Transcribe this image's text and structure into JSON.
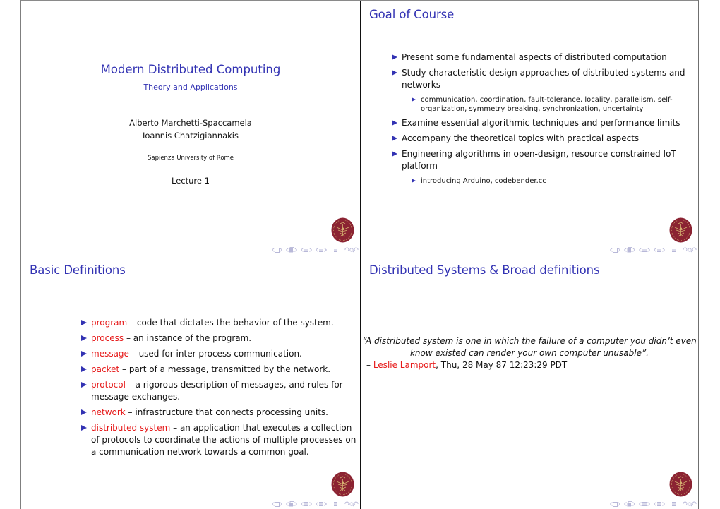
{
  "slides": [
    {
      "type": "title",
      "title": "Modern Distributed Computing",
      "subtitle": "Theory and Applications",
      "authors": [
        "Alberto Marchetti-Spaccamela",
        "Ioannis Chatzigiannakis"
      ],
      "institute": "Sapienza University of Rome",
      "date": "Lecture 1"
    },
    {
      "type": "bullets",
      "title": "Goal of Course",
      "items": [
        {
          "text": "Present some fundamental aspects of distributed computation"
        },
        {
          "text": "Study characteristic design approaches of distributed systems and networks",
          "subitems": [
            "communication, coordination, fault-tolerance, locality, parallelism, self-organization, symmetry breaking, synchronization, uncertainty"
          ]
        },
        {
          "text": "Examine essential algorithmic techniques and performance limits"
        },
        {
          "text": "Accompany the theoretical topics with practical aspects"
        },
        {
          "text": "Engineering algorithms in open-design, resource constrained IoT platform",
          "subitems": [
            "introducing Arduino, codebender.cc"
          ]
        }
      ]
    },
    {
      "type": "definitions",
      "title": "Basic Definitions",
      "items": [
        {
          "term": "program",
          "definition": " – code that dictates the behavior of the system."
        },
        {
          "term": "process",
          "definition": " – an instance of the program."
        },
        {
          "term": "message",
          "definition": " – used for inter process communication."
        },
        {
          "term": "packet",
          "definition": " – part of a message, transmitted by the network."
        },
        {
          "term": "protocol",
          "definition": " – a rigorous description of messages, and rules for message exchanges."
        },
        {
          "term": "network",
          "definition": " – infrastructure that connects processing units."
        },
        {
          "term": "distributed system",
          "definition": " – an application that executes a collection of protocols to coordinate the actions of multiple processes on a communication network towards a common goal."
        }
      ]
    },
    {
      "type": "quote",
      "title": "Distributed Systems & Broad definitions",
      "quote": "“A distributed system is one in which the failure of a computer you didn’t even know existed can render your own computer unusable”.",
      "attribution_prefix": "– ",
      "attribution_name": "Leslie Lamport",
      "attribution_suffix": ", Thu, 28 May 87 12:23:29 PDT"
    }
  ],
  "icons": {
    "logo": "sapienza-seal-icon",
    "nav": [
      "nav-frame-icon",
      "nav-subsection-icon",
      "nav-section-icon",
      "nav-part-icon",
      "nav-toc-icon",
      "nav-search-icon"
    ]
  },
  "colors": {
    "title_blue": "#3333b3",
    "term_red": "#e61919",
    "bullet_blue": "#3333b3",
    "logo_red": "#8b2332",
    "logo_gold": "#d4b070",
    "nav_gray": "#b8b8d8"
  }
}
